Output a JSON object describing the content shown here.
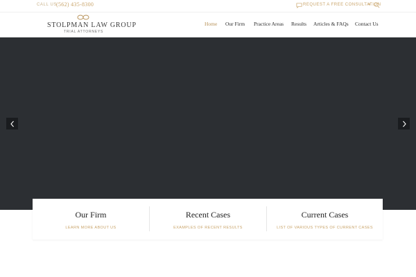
{
  "topbar": {
    "call_label": "CALL US",
    "phone": "(562) 435-8300",
    "consult_label": "REQUEST A FREE CONSULTATION",
    "consult_caret": "▾"
  },
  "logo": {
    "name": "STOLPMAN LAW GROUP",
    "tagline": "TRIAL ATTORNEYS"
  },
  "nav": {
    "items": [
      {
        "label": "Home",
        "active": true
      },
      {
        "label": "Our Firm"
      },
      {
        "label": "Practice Areas"
      },
      {
        "label": "Results"
      },
      {
        "label": "Articles & FAQs"
      },
      {
        "label": "Contact Us"
      }
    ]
  },
  "hero": {
    "prev_icon": "chevron-left-icon",
    "next_icon": "chevron-right-icon"
  },
  "cards": [
    {
      "title": "Our Firm",
      "subtitle": "LEARN MORE ABOUT US"
    },
    {
      "title": "Recent Cases",
      "subtitle": "EXAMPLES OF RECENT RESULTS"
    },
    {
      "title": "Current Cases",
      "subtitle": "LIST OF VARIOUS TYPES OF CURRENT CASES"
    }
  ],
  "colors": {
    "accent": "#c9a46a",
    "hero_bg": "#2c2f33",
    "text": "#2d2d2d"
  }
}
